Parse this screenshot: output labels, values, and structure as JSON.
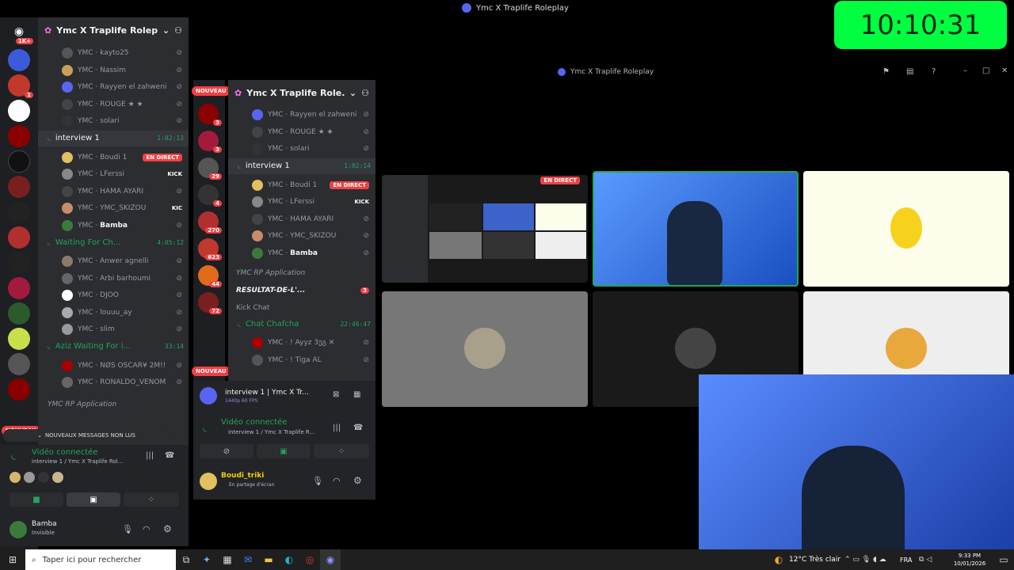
{
  "topbar": {
    "title": "Ymc X Traplife Roleplay",
    "clock": "10:10:31"
  },
  "outer": {
    "guild_name": "Ymc X Traplife Roleplay",
    "home_badge": "1K+",
    "server_badge": "1",
    "nouveau": "NOUVEAU",
    "members_top": [
      {
        "prefix": "YMC",
        "name": "kayto25"
      },
      {
        "prefix": "YMC",
        "name": "Nassim"
      },
      {
        "prefix": "YMC",
        "name": "Rayyen el zahweni"
      },
      {
        "prefix": "YMC",
        "name": "ROUGE ★ ★"
      },
      {
        "prefix": "YMC",
        "name": "solari"
      }
    ],
    "interview_channel": {
      "name": "interview 1",
      "time": "1:02:13"
    },
    "interview_members": [
      {
        "prefix": "YMC",
        "name": "Boudi 1",
        "badge": "EN DIRECT"
      },
      {
        "prefix": "YMC",
        "name": "LFerssi",
        "badge": "KICK"
      },
      {
        "prefix": "YMC",
        "name": "HAMA AYARI"
      },
      {
        "prefix": "YMC",
        "name": "YMC_SKIZOU",
        "badge": "KIC"
      },
      {
        "prefix": "YMC",
        "name": "Bamba"
      }
    ],
    "waiting_channel": {
      "name": "Waiting For Ch...",
      "time": "4:05:12"
    },
    "waiting_members": [
      {
        "prefix": "YMC",
        "name": "Anwer agnelli"
      },
      {
        "prefix": "YMC",
        "name": "Arbi barhoumi"
      },
      {
        "prefix": "YMC",
        "name": "DJOO"
      },
      {
        "prefix": "YMC",
        "name": "louuu_ay"
      },
      {
        "prefix": "YMC",
        "name": "slim"
      }
    ],
    "aziz_channel": {
      "name": "Aziz Waiting For i...",
      "time": "33:14"
    },
    "aziz_members": [
      {
        "prefix": "YMC",
        "name": "NØS OSCAR¥ 2M!!"
      },
      {
        "prefix": "YMC",
        "name": "RONALDO_VENOM"
      }
    ],
    "category": "YMC RP Application",
    "new_messages": "NOUVEAUX MESSAGES NON LUS",
    "voice_status": "Vidéo connectée",
    "voice_channel": "interview 1 / Ymc X Traplife Rol...",
    "user_name": "Bamba",
    "user_status": "Invisible"
  },
  "inner": {
    "window_title": "Ymc X Traplife Roleplay",
    "guild_name": "Ymc X Traplife Role...",
    "nouveau": "NOUVEAU",
    "rail_badges": [
      "3",
      "3",
      "29",
      "4",
      "270",
      "623",
      "44",
      "72"
    ],
    "members_top": [
      {
        "prefix": "YMC",
        "name": "Rayyen el zahweni"
      },
      {
        "prefix": "YMC",
        "name": "ROUGE ★ ★"
      },
      {
        "prefix": "YMC",
        "name": "solari"
      }
    ],
    "interview_channel": {
      "name": "interview 1",
      "time": "1:02:14"
    },
    "interview_members": [
      {
        "prefix": "YMC",
        "name": "Boudi 1",
        "badge": "EN DIRECT"
      },
      {
        "prefix": "YMC",
        "name": "LFerssi",
        "badge": "KICK"
      },
      {
        "prefix": "YMC",
        "name": "HAMA AYARI"
      },
      {
        "prefix": "YMC",
        "name": "YMC_SKIZOU"
      },
      {
        "prefix": "YMC",
        "name": "Bamba"
      }
    ],
    "category": "YMC RP Application",
    "results_channel": "RESULTAT-DE-L'...",
    "results_badge": "3",
    "kick_category": "Kick Chat",
    "chat_channel": {
      "name": "Chat Chafcha",
      "time": "22:46:47"
    },
    "chat_members": [
      {
        "prefix": "YMC",
        "name": "! Ayyz 3ეგ ✕"
      },
      {
        "prefix": "YMC",
        "name": "! Tiga AL"
      }
    ],
    "stream_title": "interview 1 | Ymc X Tr...",
    "stream_quality": "1440p 60 FPS",
    "voice_status": "Vidéo connectée",
    "voice_channel": "interview 1 / Ymc X Traplife R...",
    "user_name": "Boudi_triki",
    "user_status": "En partage d'écran"
  },
  "stage": {
    "live_label": "EN DIRECT"
  },
  "taskbar": {
    "search_placeholder": "Taper ici pour rechercher",
    "weather": "12°C  Très clair",
    "lang": "FRA",
    "time": "9:33 PM",
    "date": "10/01/2026"
  }
}
